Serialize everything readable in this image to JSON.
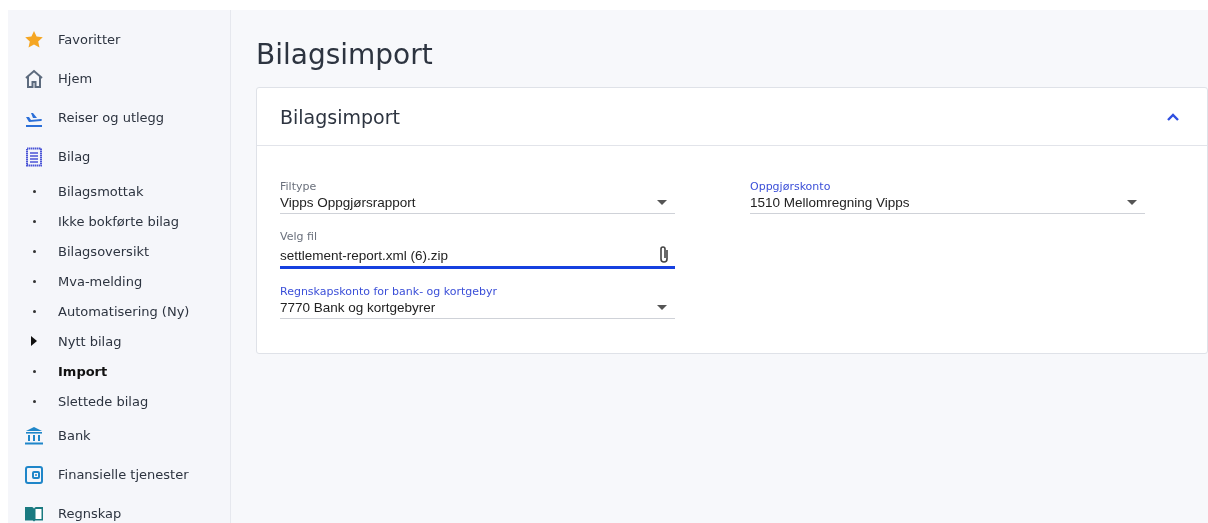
{
  "sidebar": {
    "items": [
      {
        "kind": "main",
        "label": "Favoritter"
      },
      {
        "kind": "main",
        "label": "Hjem"
      },
      {
        "kind": "main",
        "label": "Reiser og utlegg"
      },
      {
        "kind": "main",
        "label": "Bilag"
      },
      {
        "kind": "sub",
        "label": "Bilagsmottak",
        "selected": false,
        "expandable": false
      },
      {
        "kind": "sub",
        "label": "Ikke bokførte bilag",
        "selected": false,
        "expandable": false
      },
      {
        "kind": "sub",
        "label": "Bilagsoversikt",
        "selected": false,
        "expandable": false
      },
      {
        "kind": "sub",
        "label": "Mva-melding",
        "selected": false,
        "expandable": false
      },
      {
        "kind": "sub",
        "label": "Automatisering (Ny)",
        "selected": false,
        "expandable": false
      },
      {
        "kind": "sub",
        "label": "Nytt bilag",
        "selected": false,
        "expandable": true
      },
      {
        "kind": "sub",
        "label": "Import",
        "selected": true,
        "expandable": false
      },
      {
        "kind": "sub",
        "label": "Slettede bilag",
        "selected": false,
        "expandable": false
      },
      {
        "kind": "main",
        "label": "Bank"
      },
      {
        "kind": "main",
        "label": "Finansielle tjenester"
      },
      {
        "kind": "main",
        "label": "Regnskap"
      }
    ]
  },
  "page": {
    "title": "Bilagsimport"
  },
  "card": {
    "title": "Bilagsimport",
    "expanded": true,
    "columns": [
      {
        "fields": [
          {
            "kind": "select",
            "label": "Filtype",
            "value": "Vipps Oppgjørsrapport",
            "label_accent": false,
            "focused": false
          },
          {
            "kind": "file",
            "label": "Velg fil",
            "value": "settlement-report.xml (6).zip",
            "label_accent": false,
            "focused": true
          },
          {
            "kind": "select",
            "label": "Regnskapskonto for bank- og kortgebyr",
            "value": "7770 Bank og kortgebyrer",
            "label_accent": true,
            "focused": false
          }
        ]
      },
      {
        "fields": [
          {
            "kind": "select",
            "label": "Oppgjørskonto",
            "value": "1510 Mellomregning Vipps",
            "label_accent": true,
            "focused": false
          }
        ]
      }
    ]
  }
}
